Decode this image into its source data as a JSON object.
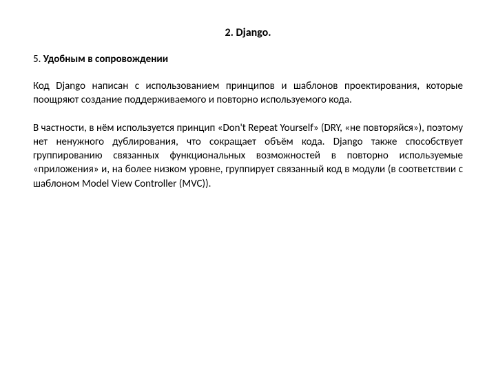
{
  "title": "2. Django.",
  "section": {
    "number": "5. ",
    "heading": "Удобным в сопровождении"
  },
  "paragraphs": [
    "Код Django написан с использованием принципов и шаблонов проектирования, которые поощряют создание поддерживаемого и повторно используемого кода.",
    "В частности, в нём используется принцип «Don't Repeat Yourself» (DRY, «не повторяйся»), поэтому нет ненужного дублирования, что сокращает объём кода. Django также способствует группированию связанных функциональных возможностей в повторно используемые «приложения» и, на более низком уровне, группирует связанный код в модули (в соответствии с шаблоном Model View Controller (MVC))."
  ]
}
